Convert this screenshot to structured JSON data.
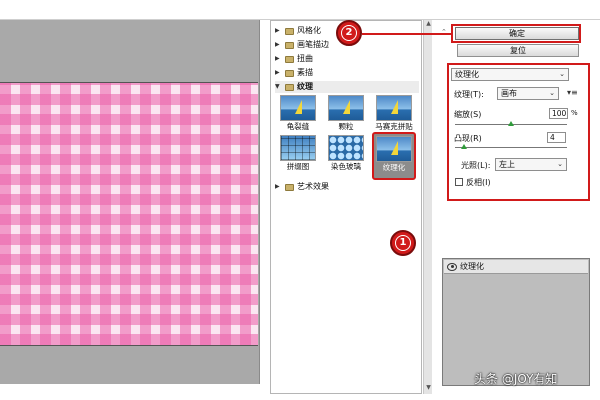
{
  "preview": {
    "pattern_colors": {
      "pink": "#ea60aa",
      "light": "#fbe6f2"
    }
  },
  "gallery": {
    "categories": [
      {
        "label": "风格化",
        "open": false
      },
      {
        "label": "画笔描边",
        "open": false
      },
      {
        "label": "扭曲",
        "open": false
      },
      {
        "label": "素描",
        "open": false
      },
      {
        "label": "纹理",
        "open": true
      },
      {
        "label": "艺术效果",
        "open": false
      }
    ],
    "thumbnails": [
      {
        "label": "龟裂缝"
      },
      {
        "label": "颗粒"
      },
      {
        "label": "马赛克拼贴"
      },
      {
        "label": "拼缀图"
      },
      {
        "label": "染色玻璃"
      },
      {
        "label": "纹理化",
        "selected": true
      }
    ]
  },
  "buttons": {
    "ok": "确定",
    "reset": "复位"
  },
  "badges": {
    "one": "1",
    "two": "2"
  },
  "params": {
    "filter_select": "纹理化",
    "texture_label": "纹理(T):",
    "texture_value": "画布",
    "scale_label": "缩放(S)",
    "scale_value": "100",
    "scale_unit": "%",
    "scale_fraction": 0.5,
    "relief_label": "凸现(R)",
    "relief_value": "4",
    "relief_fraction": 0.08,
    "light_label": "光照(L):",
    "light_value": "左上",
    "invert_label": "反相(I)"
  },
  "layers": {
    "row_label": "纹理化"
  },
  "watermark": "头条 @JOY有知",
  "colors": {
    "highlight": "#d11a1a"
  }
}
